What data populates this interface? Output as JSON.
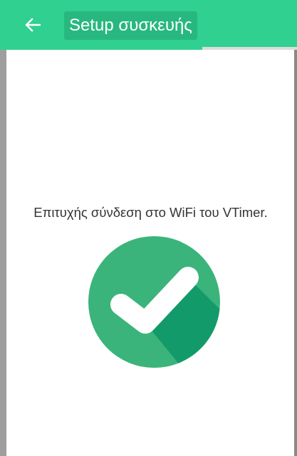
{
  "appbar": {
    "title": "Setup συσκευής",
    "back_icon": "arrow-left-icon",
    "color": "#2fd090"
  },
  "progress": {
    "fraction": 0.68
  },
  "content": {
    "message": "Επιτυχής σύνδεση στο WiFi του VTimer.",
    "status_icon": "check-circle-icon",
    "icon_colors": {
      "circle": "#3ab47a",
      "shadow": "#139a6a",
      "check": "#ffffff"
    }
  }
}
